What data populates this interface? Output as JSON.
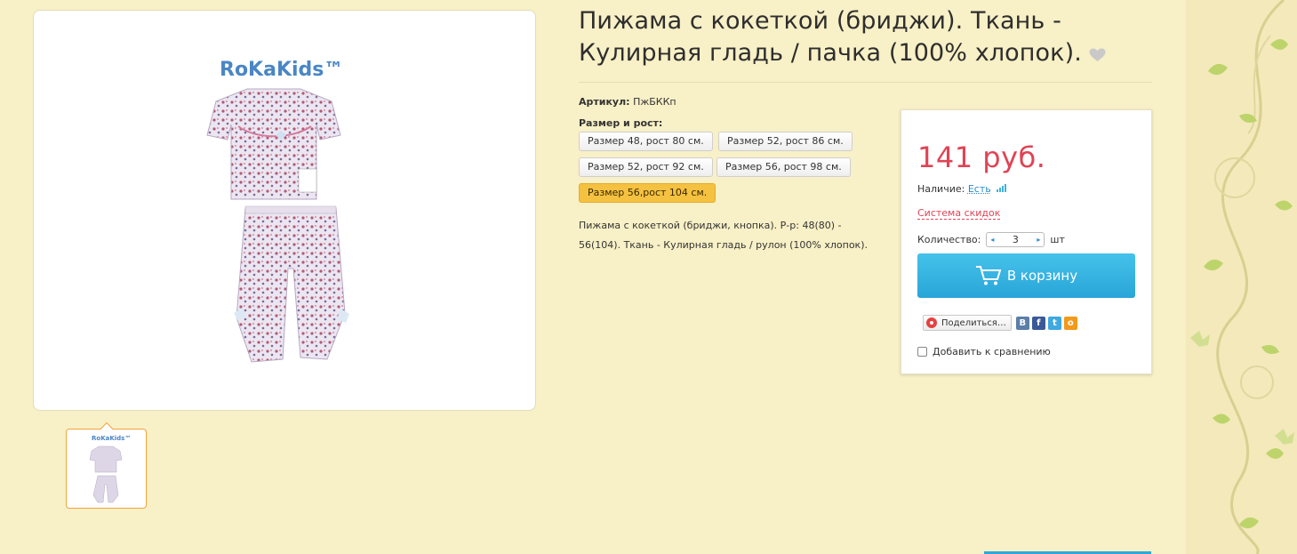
{
  "product": {
    "title": "Пижама с кокеткой (бриджи). Ткань - Кулирная гладь / пачка (100% хлопок).",
    "brand_logo": "RoKaKids™",
    "article_label": "Артикул:",
    "article_value": "ПжБККп",
    "size_label": "Размер и рост:",
    "sizes": [
      {
        "label": "Размер 48, рост 80 см.",
        "selected": false
      },
      {
        "label": "Размер 52, рост 86 см.",
        "selected": false
      },
      {
        "label": "Размер 52, рост 92 см.",
        "selected": false
      },
      {
        "label": "Размер 56, рост 98 см.",
        "selected": false
      },
      {
        "label": "Размер 56,рост 104 см.",
        "selected": true
      }
    ],
    "description": "Пижама с кокеткой (бриджи, кнопка). Р-р: 48(80) - 56(104). Ткань - Кулирная гладь / рулон (100% хлопок)."
  },
  "buy_box": {
    "price": "141 руб.",
    "availability_label": "Наличие:",
    "availability_value": "Есть",
    "discount_link": "Система скидок",
    "quantity_label": "Количество:",
    "quantity_value": "3",
    "quantity_unit": "шт",
    "cart_button": "В корзину",
    "share_button": "Поделиться…",
    "compare_label": "Добавить к сравнению"
  },
  "colors": {
    "page_bg": "#f8f0c6",
    "price": "#e04355",
    "cart_button": "#2fa8da",
    "selected_size": "#f5c141",
    "thumb_border": "#f3a33c"
  }
}
